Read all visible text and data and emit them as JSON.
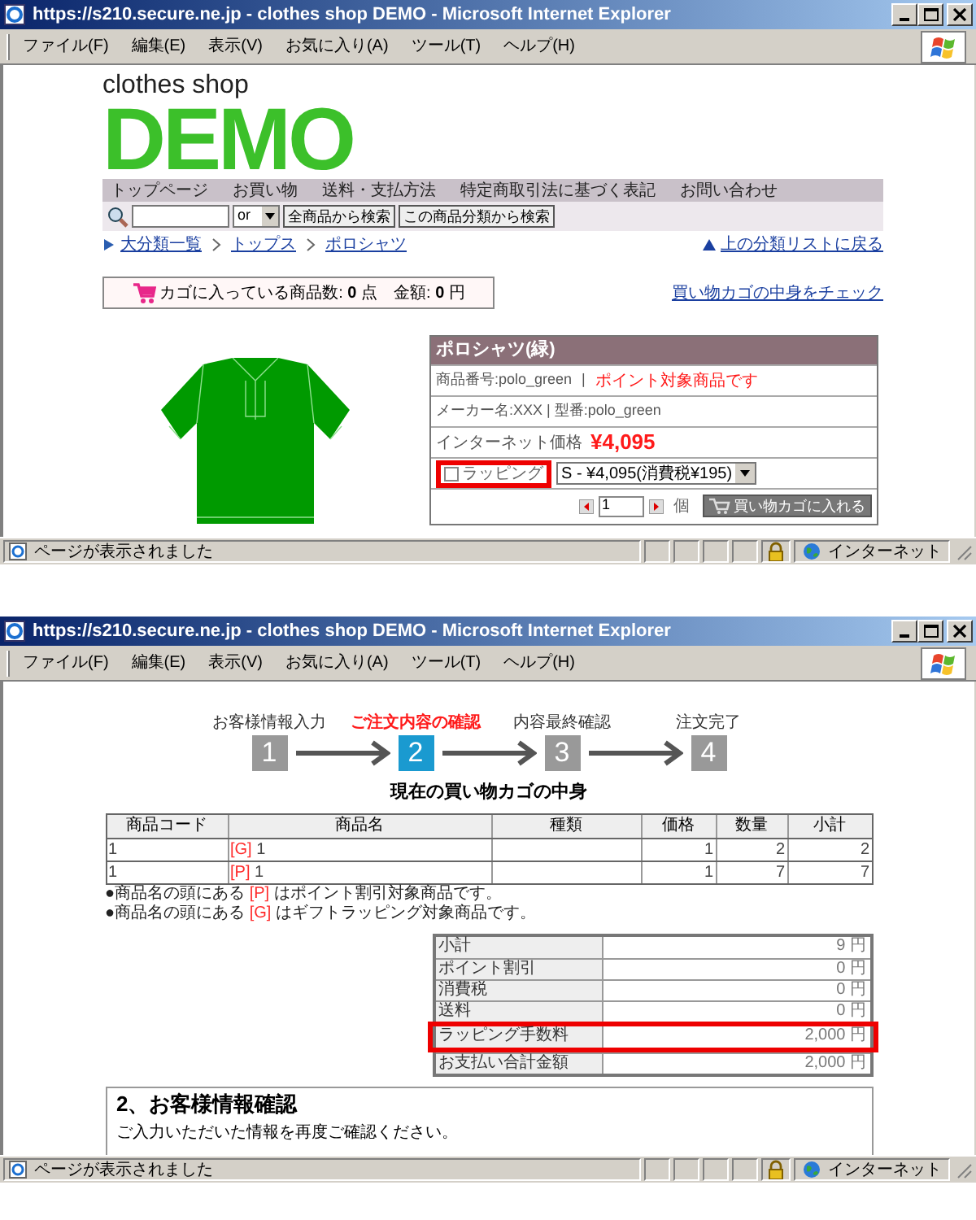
{
  "product_window": {
    "title": "https://s210.secure.ne.jp - clothes shop DEMO - Microsoft Internet Explorer",
    "menu": [
      "ファイル(F)",
      "編集(E)",
      "表示(V)",
      "お気に入り(A)",
      "ツール(T)",
      "ヘルプ(H)"
    ],
    "logo": {
      "small": "clothes shop",
      "big": "DEMO"
    },
    "nav": [
      "トップページ",
      "お買い物",
      "送料・支払方法",
      "特定商取引法に基づく表記",
      "お問い合わせ"
    ],
    "search": {
      "connector": "or",
      "buttons": [
        "全商品から検索",
        "この商品分類から検索"
      ]
    },
    "breadcrumb": [
      "大分類一覧",
      "トップス",
      "ポロシャツ"
    ],
    "back_link": "上の分類リストに戻る",
    "cart_summary": {
      "label": "カゴに入っている商品数:",
      "count": "0",
      "count_unit": "点",
      "amount_label": "金額:",
      "amount": "0",
      "amount_unit": "円"
    },
    "cart_link": "買い物カゴの中身をチェック",
    "product": {
      "name": "ポロシャツ(緑)",
      "code": "商品番号:polo_green",
      "separator": "|",
      "point_note": "ポイント対象商品です",
      "maker": "メーカー名:XXX | 型番:polo_green",
      "price_label": "インターネット価格",
      "price": "¥4,095",
      "wrapping": {
        "label": "ラッピング",
        "checked": false,
        "highlighted": true
      },
      "variant": "S - ¥4,095(消費税¥195)",
      "quantity": "1",
      "quantity_unit": "個",
      "add_button": "買い物カゴに入れる"
    },
    "status": "ページが表示されました",
    "zone": "インターネット"
  },
  "checkout_window": {
    "title": "https://s210.secure.ne.jp - clothes shop DEMO - Microsoft Internet Explorer",
    "menu": [
      "ファイル(F)",
      "編集(E)",
      "表示(V)",
      "お気に入り(A)",
      "ツール(T)",
      "ヘルプ(H)"
    ],
    "steps": [
      {
        "number": "1",
        "label": "お客様情報入力",
        "selected": false
      },
      {
        "number": "2",
        "label": "ご注文内容の確認",
        "selected": true
      },
      {
        "number": "3",
        "label": "内容最終確認",
        "selected": false
      },
      {
        "number": "4",
        "label": "注文完了",
        "selected": false
      }
    ],
    "cart_heading": "現在の買い物カゴの中身",
    "cart_table": {
      "columns": [
        "商品コード",
        "商品名",
        "種類",
        "価格",
        "数量",
        "小計"
      ],
      "rows": [
        {
          "code": "1",
          "tag": "[G]",
          "name": "1",
          "price": "1",
          "quantity": "2",
          "subtotal": "2"
        },
        {
          "code": "1",
          "tag": "[P]",
          "name": "1",
          "price": "1",
          "quantity": "7",
          "subtotal": "7"
        }
      ]
    },
    "notes": [
      {
        "prefix": "●商品名の頭にある",
        "tag": "[P]",
        "suffix": "はポイント割引対象商品です。"
      },
      {
        "prefix": "●商品名の頭にある",
        "tag": "[G]",
        "suffix": "はギフトラッピング対象商品です。"
      }
    ],
    "summary": [
      {
        "label": "小計",
        "value": "9 円",
        "highlighted": false
      },
      {
        "label": "ポイント割引",
        "value": "0 円",
        "highlighted": false
      },
      {
        "label": "消費税",
        "value": "0 円",
        "highlighted": false
      },
      {
        "label": "送料",
        "value": "0 円",
        "highlighted": false
      },
      {
        "label": "ラッピング手数料",
        "value": "2,000 円",
        "highlighted": true
      },
      {
        "label": "お支払い合計金額",
        "value": "2,000 円",
        "highlighted": false
      }
    ],
    "section": {
      "heading": "2、お客様情報確認",
      "text": "ご入力いただいた情報を再度ご確認ください。"
    },
    "status": "ページが表示されました",
    "zone": "インターネット"
  }
}
